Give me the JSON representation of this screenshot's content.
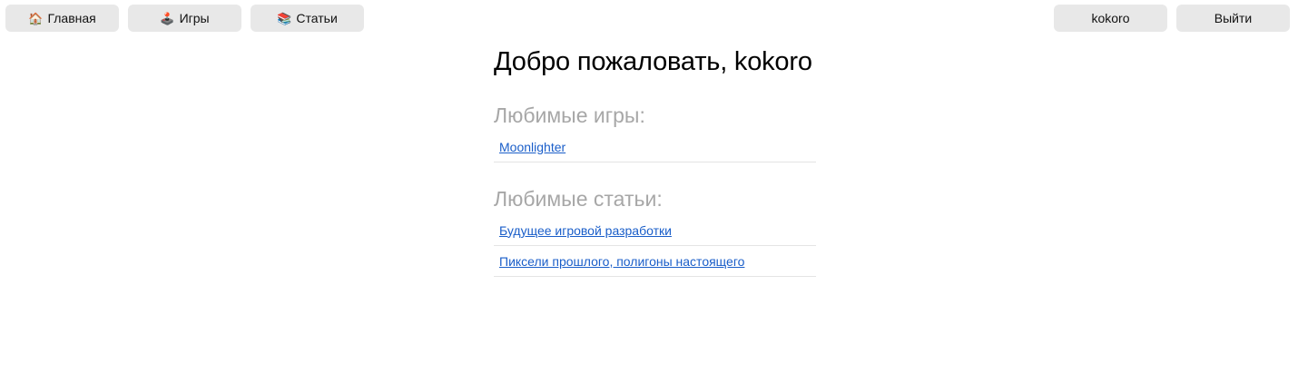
{
  "nav": {
    "home": {
      "icon": "🏠",
      "label": "Главная"
    },
    "games": {
      "icon": "🕹️",
      "label": "Игры"
    },
    "articles": {
      "icon": "📚",
      "label": "Статьи"
    },
    "user": {
      "label": "kokoro"
    },
    "logout": {
      "label": "Выйти"
    }
  },
  "main": {
    "title": "Добро пожаловать, kokoro",
    "favorite_games": {
      "heading": "Любимые игры:",
      "items": [
        "Moonlighter"
      ]
    },
    "favorite_articles": {
      "heading": "Любимые статьи:",
      "items": [
        "Будущее игровой разработки",
        "Пиксели прошлого, полигоны настоящего"
      ]
    }
  },
  "colors": {
    "button_bg": "#e8e8e8",
    "section_heading": "#a7a7a7",
    "link": "#1a5ec9",
    "divider": "#e4e4e4"
  }
}
